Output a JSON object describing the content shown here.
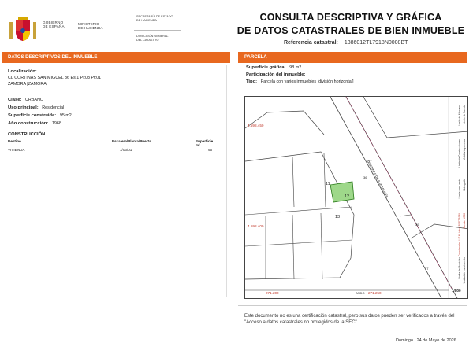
{
  "header": {
    "gov_line1": "GOBIERNO",
    "gov_line2": "DE ESPAÑA",
    "ministry_line1": "MINISTERIO",
    "ministry_line2": "DE HACIENDA",
    "secretaria_line1": "SECRETARÍA DE ESTADO",
    "secretaria_line2": "DE HACIENDA",
    "direccion_line1": "DIRECCIÓN GENERAL",
    "direccion_line2": "DEL CATASTRO",
    "title_line1": "CONSULTA DESCRIPTIVA Y GRÁFICA",
    "title_line2": "DE DATOS CATASTRALES DE BIEN INMUEBLE",
    "ref_label": "Referencia catastral:",
    "ref_value": "1386012TL7918N0008BT"
  },
  "left": {
    "bar_title": "DATOS DESCRIPTIVOS DEL INMUEBLE",
    "localizacion_label": "Localización:",
    "address_line1": "CL CORTINAS SAN MIGUEL 36 Es:1 Pl:03 Pt:01",
    "address_line2": "ZAMORA [ZAMORA]",
    "clase_label": "Clase:",
    "clase_value": "URBANO",
    "uso_label": "Uso principal:",
    "uso_value": "Residencial",
    "superficie_label": "Superficie construida:",
    "superficie_value": "95 m2",
    "anio_label": "Año construcción:",
    "anio_value": "1968",
    "construccion_title": "CONSTRUCCIÓN",
    "table_headers": [
      "Destino",
      "Escalera/Planta/Puerta",
      "Superficie m²"
    ],
    "table_rows": [
      [
        "VIVIENDA",
        "1/03/01",
        "95"
      ]
    ]
  },
  "right": {
    "bar_title": "PARCELA",
    "sup_grafica_label": "Superficie gráfica:",
    "sup_grafica_value": "98 m2",
    "participacion_label": "Participación del inmueble:",
    "tipo_label": "Tipo:",
    "tipo_value": "Parcela con varios inmuebles [división horizontal]",
    "map": {
      "y_top": "4.598.450",
      "y_mid": "4.598.400",
      "x_left": "271.200",
      "x_mid": "271.250",
      "parcel_11": "11",
      "parcel_13": "13",
      "parcel_12": "12",
      "street_label": "CORTINAS DE SAN MIGUEL",
      "street_bottom": "ANDO",
      "num_36": "36",
      "num_27": "27",
      "num_39": "39",
      "num_17": "17",
      "scale_ratio": "1/800",
      "side_text1": "Límite de Manzana",
      "side_text2": "Límite de Parcela",
      "side_text3": "Límite de Construcciones",
      "side_text4": "Mobiliario y aceras",
      "side_text5": "Límite zona verde",
      "side_text6": "Hidrografía",
      "side_text7": "Coordenadas U.T.M. Huso 30 ETRS89",
      "side_text8": "Escala: 1/800",
      "side_text9": "Límite de Municipio",
      "side_text10": "Unidad de construcción",
      "accent": "#e8681f"
    },
    "notice": "Este documento no es una certificación catastral, pero sus datos pueden ser verificados a través del \"Acceso a datos catastrales no protegidos de la SEC\"",
    "date": "Domingo , 24 de Mayo de 2026"
  }
}
